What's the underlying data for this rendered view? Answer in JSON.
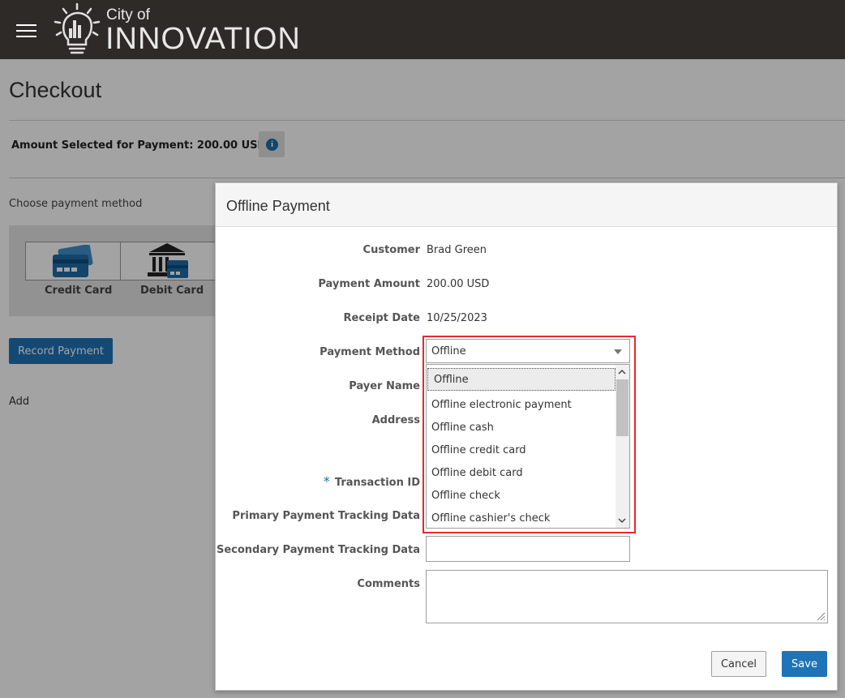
{
  "header": {
    "logo_small": "City of",
    "logo_big": "INNOVATION"
  },
  "page": {
    "title": "Checkout",
    "amount_selected": "Amount Selected for Payment: 200.00 USD",
    "choose_label": "Choose payment method",
    "methods": [
      {
        "label": "Credit Card",
        "icon": "credit-card-icon"
      },
      {
        "label": "Debit Card",
        "icon": "bank-icon"
      }
    ],
    "record_payment_label": "Record Payment",
    "add_label": "Add"
  },
  "dialog": {
    "title": "Offline Payment",
    "fields": {
      "customer": {
        "label": "Customer",
        "value": "Brad Green"
      },
      "payment_amount": {
        "label": "Payment Amount",
        "value": "200.00 USD"
      },
      "receipt_date": {
        "label": "Receipt Date",
        "value": "10/25/2023"
      },
      "payment_method": {
        "label": "Payment Method",
        "value": "Offline"
      },
      "payer_name": {
        "label": "Payer Name"
      },
      "address": {
        "label": "Address"
      },
      "transaction_id": {
        "label": "Transaction ID",
        "required_mark": "*"
      },
      "primary_tracking": {
        "label": "Primary Payment Tracking Data"
      },
      "secondary_tracking": {
        "label": "Secondary Payment Tracking Data"
      },
      "comments": {
        "label": "Comments"
      }
    },
    "payment_method_options": [
      "Offline",
      "Offline electronic payment",
      "Offline cash",
      "Offline credit card",
      "Offline debit card",
      "Offline check",
      "Offline cashier's check"
    ],
    "cancel_label": "Cancel",
    "save_label": "Save"
  },
  "colors": {
    "header_bg": "#2e2a27",
    "primary_button": "#1f73b7",
    "highlight_border": "#e8292f"
  }
}
